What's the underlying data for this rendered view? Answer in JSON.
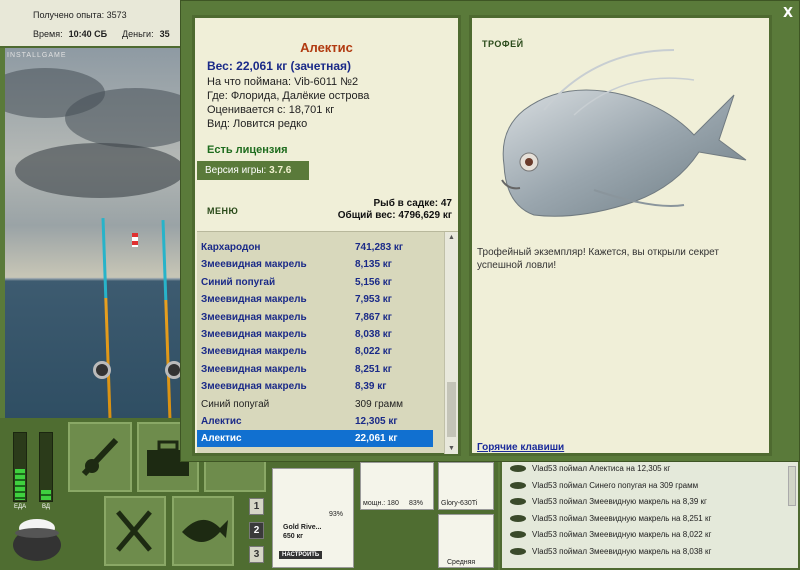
{
  "topbar": {
    "xp_label": "Получено опыта:",
    "xp_value": "3573",
    "time_label": "Время:",
    "time_value": "10:40 СБ",
    "money_label": "Деньги:",
    "money_value": "35"
  },
  "scene": {
    "watermark": "INSTALLGAME"
  },
  "gauges": {
    "food_label": "ЕДА",
    "drink_label": "ВД",
    "food_level": 0.45,
    "drink_level": 0.15
  },
  "tackle": {
    "num_buttons": [
      "1",
      "2",
      "3"
    ],
    "rod_name": "Gold Rive...",
    "rod_weight": "650 кг",
    "rod_durability": "93%",
    "setup_button": "НАСТРОИТЬ",
    "reel_label": "мощн.: 180",
    "reel_durability": "83%",
    "line_label": "Glory-630Ti",
    "lure_label": "Средняя"
  },
  "log": {
    "entries": [
      "Vlad53 поймал Алектиса на 12,305 кг",
      "Vlad53 поймал Синего попугая на 309 грамм",
      "Vlad53 поймал Змеевидную макрель на 8,39 кг",
      "Vlad53 поймал Змеевидную макрель на 8,251 кг",
      "Vlad53 поймал Змеевидную макрель на 8,022 кг",
      "Vlad53 поймал Змеевидную макрель на 8,038 кг"
    ]
  },
  "dialog": {
    "close": "X",
    "fish_name": "Алектис",
    "weight": "Вес: 22,061 кг (зачетная)",
    "caught_with": "На что поймана: Vib-6011 №2",
    "location": "Где: Флорида, Далёкие острова",
    "rated_from": "Оценивается с: 18,701 кг",
    "kind": "Вид: Ловится редко",
    "license": "Есть лицензия",
    "version_label": "Версия игры:",
    "version_value": "3.7.6",
    "menu": "МЕНЮ",
    "cage_count": "Рыб в садке: 47",
    "cage_weight": "Общий вес: 4796,629 кг",
    "catch_list": [
      {
        "name": "Кархародон",
        "weight": "741,283 кг",
        "style": "bold"
      },
      {
        "name": "Змеевидная макрель",
        "weight": "8,135 кг",
        "style": "bold"
      },
      {
        "name": "Синий попугай",
        "weight": "5,156 кг",
        "style": "bold"
      },
      {
        "name": "Змеевидная макрель",
        "weight": "7,953 кг",
        "style": "bold"
      },
      {
        "name": "Змеевидная макрель",
        "weight": "7,867 кг",
        "style": "bold"
      },
      {
        "name": "Змеевидная макрель",
        "weight": "8,038 кг",
        "style": "bold"
      },
      {
        "name": "Змеевидная макрель",
        "weight": "8,022 кг",
        "style": "bold"
      },
      {
        "name": "Змеевидная макрель",
        "weight": "8,251 кг",
        "style": "bold"
      },
      {
        "name": "Змеевидная макрель",
        "weight": "8,39 кг",
        "style": "bold"
      },
      {
        "name": "Синий попугай",
        "weight": "309 грамм",
        "style": "plain"
      },
      {
        "name": "Алектис",
        "weight": "12,305 кг",
        "style": "bold"
      },
      {
        "name": "Алектис",
        "weight": "22,061 кг",
        "style": "selected"
      }
    ],
    "trophy_title": "ТРОФЕЙ",
    "trophy_text": "Трофейный экземпляр! Кажется, вы открыли секрет успешной ловли!",
    "hotkeys": "Горячие клавиши"
  }
}
